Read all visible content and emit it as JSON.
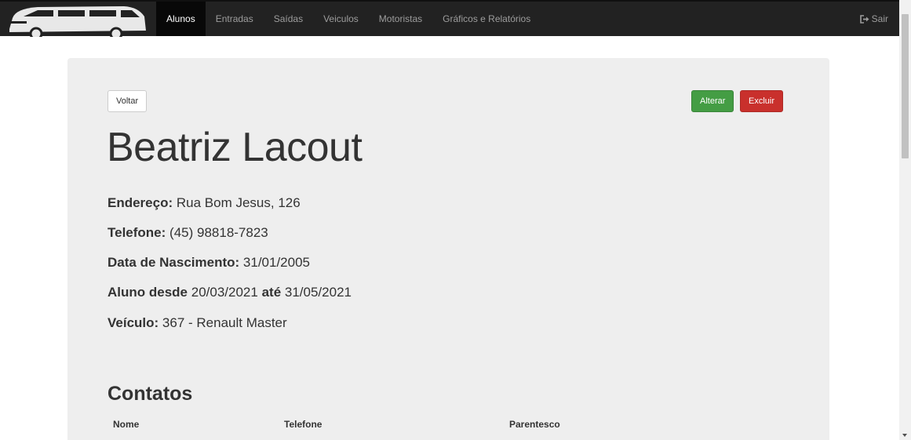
{
  "nav": {
    "logo_icon": "van-logo-icon",
    "items": [
      {
        "label": "Alunos",
        "active": true
      },
      {
        "label": "Entradas",
        "active": false
      },
      {
        "label": "Saídas",
        "active": false
      },
      {
        "label": "Veiculos",
        "active": false
      },
      {
        "label": "Motoristas",
        "active": false
      },
      {
        "label": "Gráficos e Relatórios",
        "active": false
      }
    ],
    "logout_label": "Sair",
    "logout_icon": "sign-out-icon"
  },
  "actions": {
    "back_label": "Voltar",
    "edit_label": "Alterar",
    "delete_label": "Excluir"
  },
  "student": {
    "name": "Beatriz Lacout",
    "address_label": "Endereço:",
    "address": "Rua Bom Jesus, 126",
    "phone_label": "Telefone:",
    "phone": "(45) 98818-7823",
    "birth_label": "Data de Nascimento:",
    "birth": "31/01/2005",
    "since_label": "Aluno desde",
    "since": "20/03/2021",
    "until_label": "até",
    "until": "31/05/2021",
    "vehicle_label": "Veículo:",
    "vehicle": "367 - Renault Master"
  },
  "contacts": {
    "title": "Contatos",
    "columns": [
      "Nome",
      "Telefone",
      "Parentesco"
    ]
  },
  "colors": {
    "navbar": "#222222",
    "panel": "#eeeeee",
    "success": "#449d44",
    "danger": "#c9302c"
  }
}
